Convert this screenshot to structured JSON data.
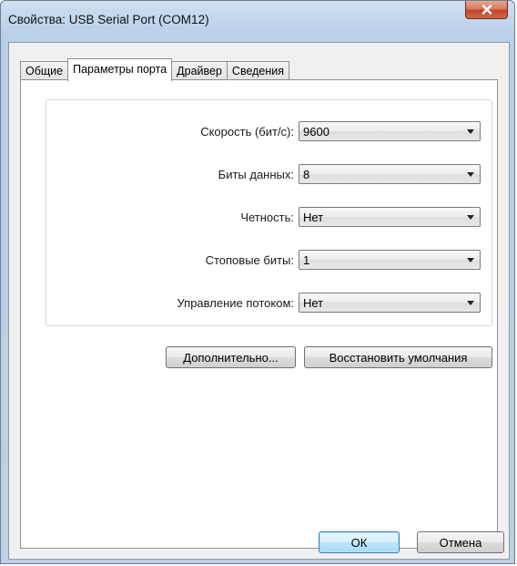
{
  "window": {
    "title": "Свойства: USB Serial Port (COM12)"
  },
  "tabs": [
    {
      "label": "Общие",
      "active": false
    },
    {
      "label": "Параметры порта",
      "active": true
    },
    {
      "label": "Драйвер",
      "active": false
    },
    {
      "label": "Сведения",
      "active": false
    }
  ],
  "settings": [
    {
      "label": "Скорость (бит/с):",
      "value": "9600"
    },
    {
      "label": "Биты данных:",
      "value": "8"
    },
    {
      "label": "Четность:",
      "value": "Нет"
    },
    {
      "label": "Стоповые биты:",
      "value": "1"
    },
    {
      "label": "Управление потоком:",
      "value": "Нет"
    }
  ],
  "buttons": {
    "advanced": "Дополнительно...",
    "restore_defaults": "Восстановить умолчания",
    "ok": "ОК",
    "cancel": "Отмена"
  },
  "icons": {
    "close": "close-icon",
    "dropdown": "chevron-down-icon"
  }
}
